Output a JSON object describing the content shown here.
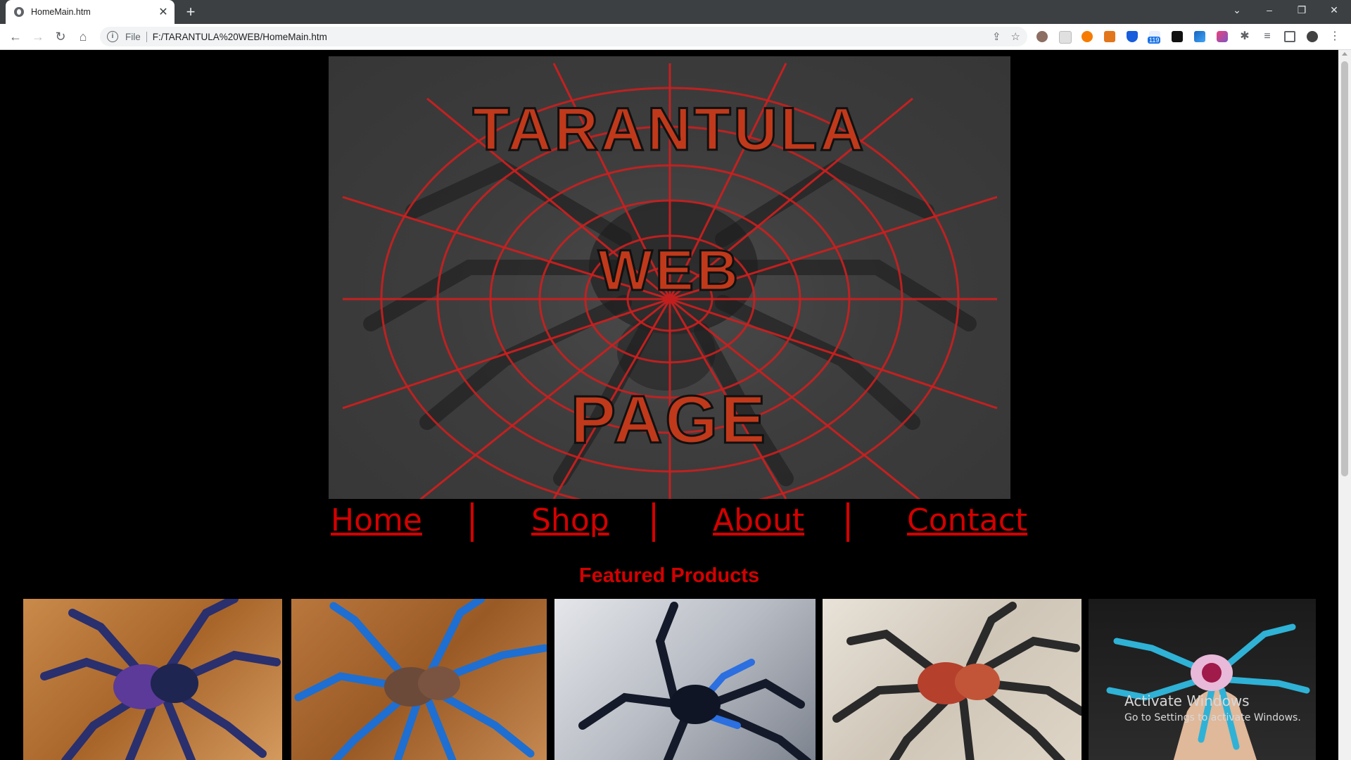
{
  "browser": {
    "tab_title": "HomeMain.htm",
    "tab_close": "✕",
    "new_tab": "+",
    "address_scheme": "File",
    "address_url": "F:/TARANTULA%20WEB/HomeMain.htm",
    "ext_badge": "119"
  },
  "banner": {
    "line1": "TARANTULA",
    "line2": "WEB",
    "line3": "PAGE"
  },
  "nav": {
    "items": [
      {
        "label": "Home"
      },
      {
        "label": "Shop"
      },
      {
        "label": "About"
      },
      {
        "label": "Contact"
      }
    ]
  },
  "featured": {
    "heading": "Featured Products"
  },
  "watermark": {
    "line1": "Activate Windows",
    "line2": "Go to Settings to activate Windows."
  },
  "colors": {
    "accent": "#d40000",
    "page_bg": "#000000",
    "banner_bg": "#3d3d3d"
  }
}
